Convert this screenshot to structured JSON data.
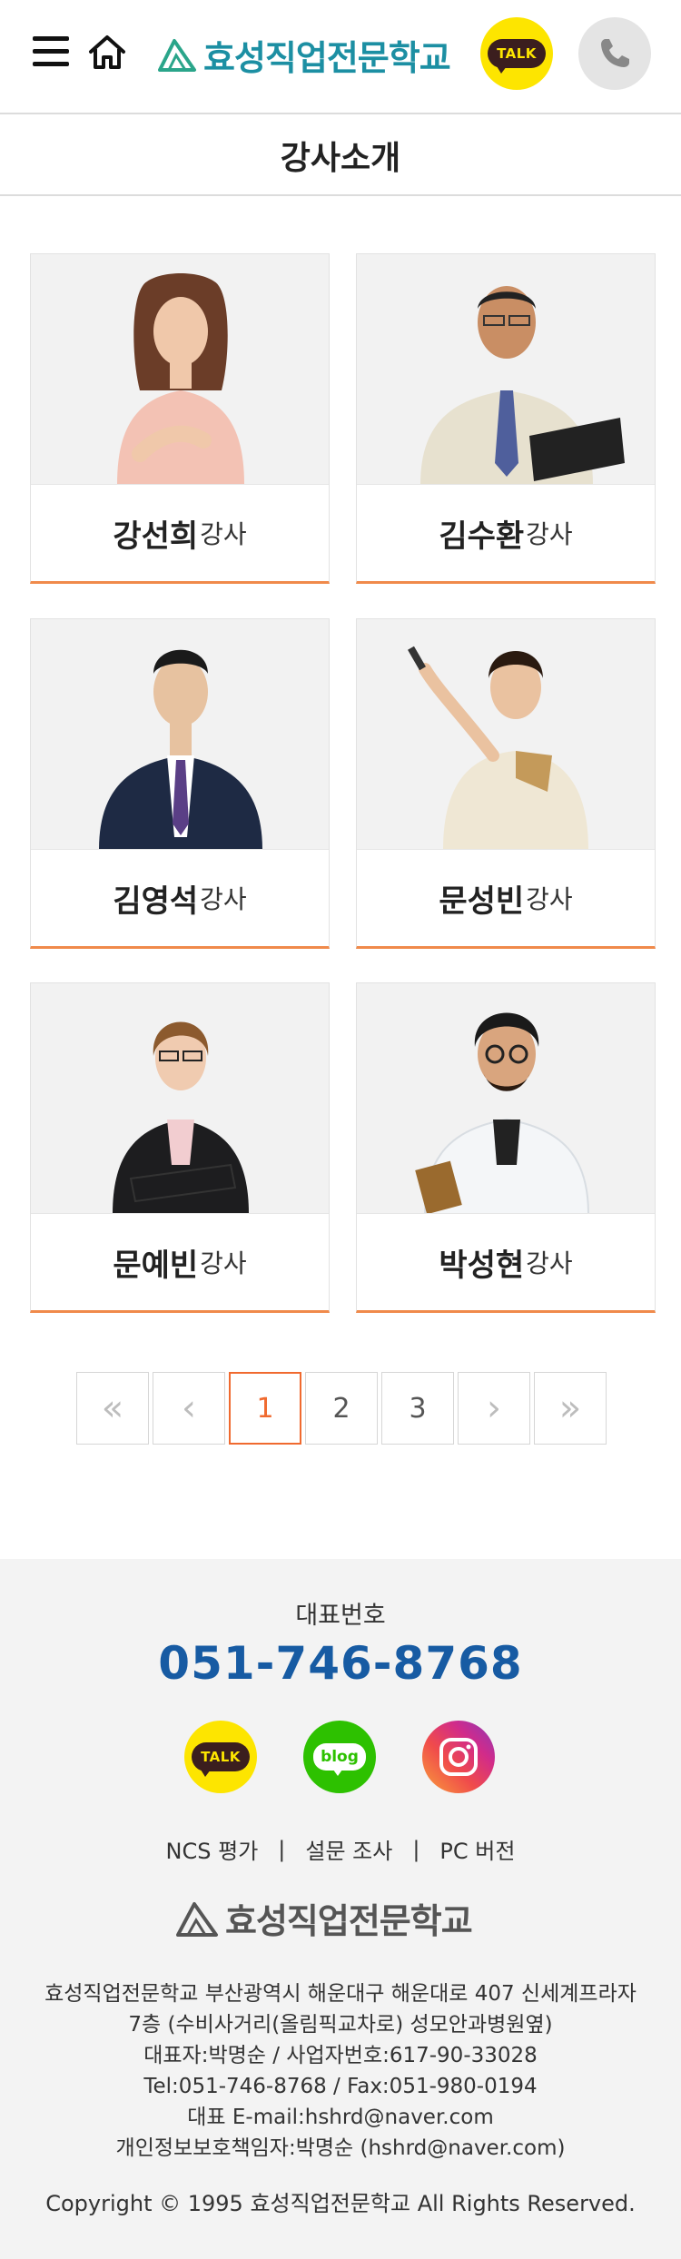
{
  "header": {
    "logo_text": "효성직업전문학교",
    "talk_label": "TALK"
  },
  "page": {
    "title": "강사소개"
  },
  "instructors": [
    {
      "name": "강선희",
      "role": "강사"
    },
    {
      "name": "김수환",
      "role": "강사"
    },
    {
      "name": "김영석",
      "role": "강사"
    },
    {
      "name": "문성빈",
      "role": "강사"
    },
    {
      "name": "문예빈",
      "role": "강사"
    },
    {
      "name": "박성현",
      "role": "강사"
    }
  ],
  "pagination": {
    "first": "«",
    "prev": "‹",
    "pages": [
      "1",
      "2",
      "3"
    ],
    "current": "1",
    "next": "›",
    "last": "»"
  },
  "footer": {
    "phone_label": "대표번호",
    "phone": "051-746-8768",
    "sns": {
      "kakao_label": "TALK",
      "blog_label": "blog"
    },
    "links": [
      "NCS 평가",
      "설문 조사",
      "PC 버전"
    ],
    "logo_text": "효성직업전문학교",
    "info_lines": [
      "효성직업전문학교 부산광역시 해운대구 해운대로 407 신세계프라자",
      "7층 (수비사거리(올림픽교차로) 성모안과병원옆)",
      "대표자:박명순 / 사업자번호:617-90-33028",
      "Tel:051-746-8768 / Fax:051-980-0194",
      "대표 E-mail:hshrd@naver.com",
      "개인정보보호책임자:박명순 (hshrd@naver.com)"
    ],
    "copyright": "Copyright © 1995 효성직업전문학교 All Rights Reserved."
  },
  "colors": {
    "accent": "#f06a2f",
    "brand": "#1c8fa3",
    "phone": "#175ba3",
    "kakao": "#fde500",
    "blog": "#2dc100"
  }
}
